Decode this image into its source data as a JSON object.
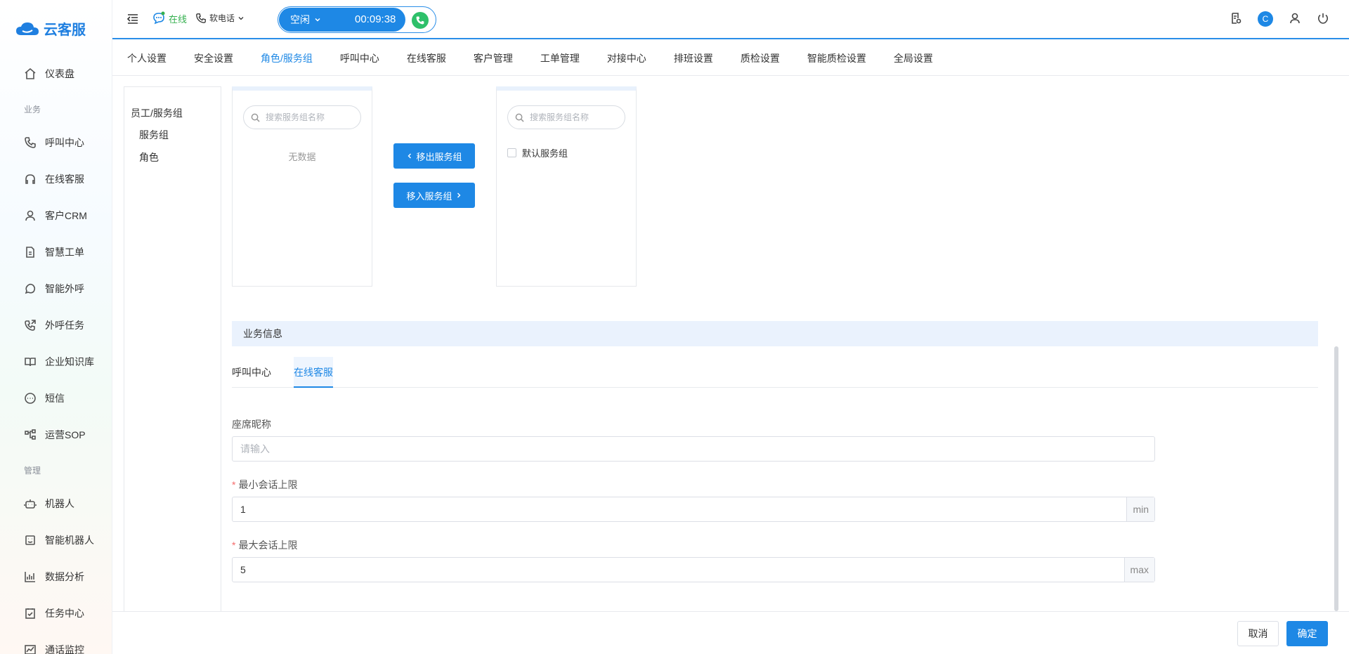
{
  "app": {
    "logo_text": "云客服"
  },
  "sidebar": {
    "items": [
      {
        "label": "仪表盘",
        "icon": "home-icon"
      },
      {
        "section": "业务"
      },
      {
        "label": "呼叫中心",
        "icon": "phone-icon"
      },
      {
        "label": "在线客服",
        "icon": "headset-icon"
      },
      {
        "label": "客户CRM",
        "icon": "user-icon"
      },
      {
        "label": "智慧工单",
        "icon": "document-icon"
      },
      {
        "label": "智能外呼",
        "icon": "whatsapp-icon"
      },
      {
        "label": "外呼任务",
        "icon": "phone-outgoing-icon"
      },
      {
        "label": "企业知识库",
        "icon": "book-icon"
      },
      {
        "label": "短信",
        "icon": "sms-icon"
      },
      {
        "label": "运营SOP",
        "icon": "flow-icon"
      },
      {
        "section": "管理"
      },
      {
        "label": "机器人",
        "icon": "robot-icon"
      },
      {
        "label": "智能机器人",
        "icon": "smart-robot-icon"
      },
      {
        "label": "数据分析",
        "icon": "bar-chart-icon"
      },
      {
        "label": "任务中心",
        "icon": "task-icon"
      },
      {
        "label": "通话监控",
        "icon": "monitor-icon"
      }
    ]
  },
  "header": {
    "status": "在线",
    "phone_mode": "软电话",
    "call_state": "空闲",
    "call_timer": "00:09:38",
    "avatar_letter": "C"
  },
  "tabs": [
    "个人设置",
    "安全设置",
    "角色/服务组",
    "呼叫中心",
    "在线客服",
    "客户管理",
    "工单管理",
    "对接中心",
    "排班设置",
    "质检设置",
    "智能质检设置",
    "全局设置"
  ],
  "tree": {
    "root": "员工/服务组",
    "children": [
      "服务组",
      "角色"
    ]
  },
  "transfer": {
    "left": {
      "search_placeholder": "搜索服务组名称",
      "empty_text": "无数据"
    },
    "right": {
      "search_placeholder": "搜索服务组名称",
      "items": [
        "默认服务组"
      ]
    },
    "move_out_label": "移出服务组",
    "move_in_label": "移入服务组"
  },
  "business": {
    "title": "业务信息",
    "tabs": [
      "呼叫中心",
      "在线客服"
    ],
    "active_tab": "在线客服",
    "fields": {
      "nickname": {
        "label": "座席昵称",
        "placeholder": "请输入",
        "value": ""
      },
      "min_sessions": {
        "label": "最小会话上限",
        "value": "1",
        "suffix": "min"
      },
      "max_sessions": {
        "label": "最大会话上限",
        "value": "5",
        "suffix": "max"
      }
    }
  },
  "footer": {
    "cancel_label": "取消",
    "ok_label": "确定"
  }
}
